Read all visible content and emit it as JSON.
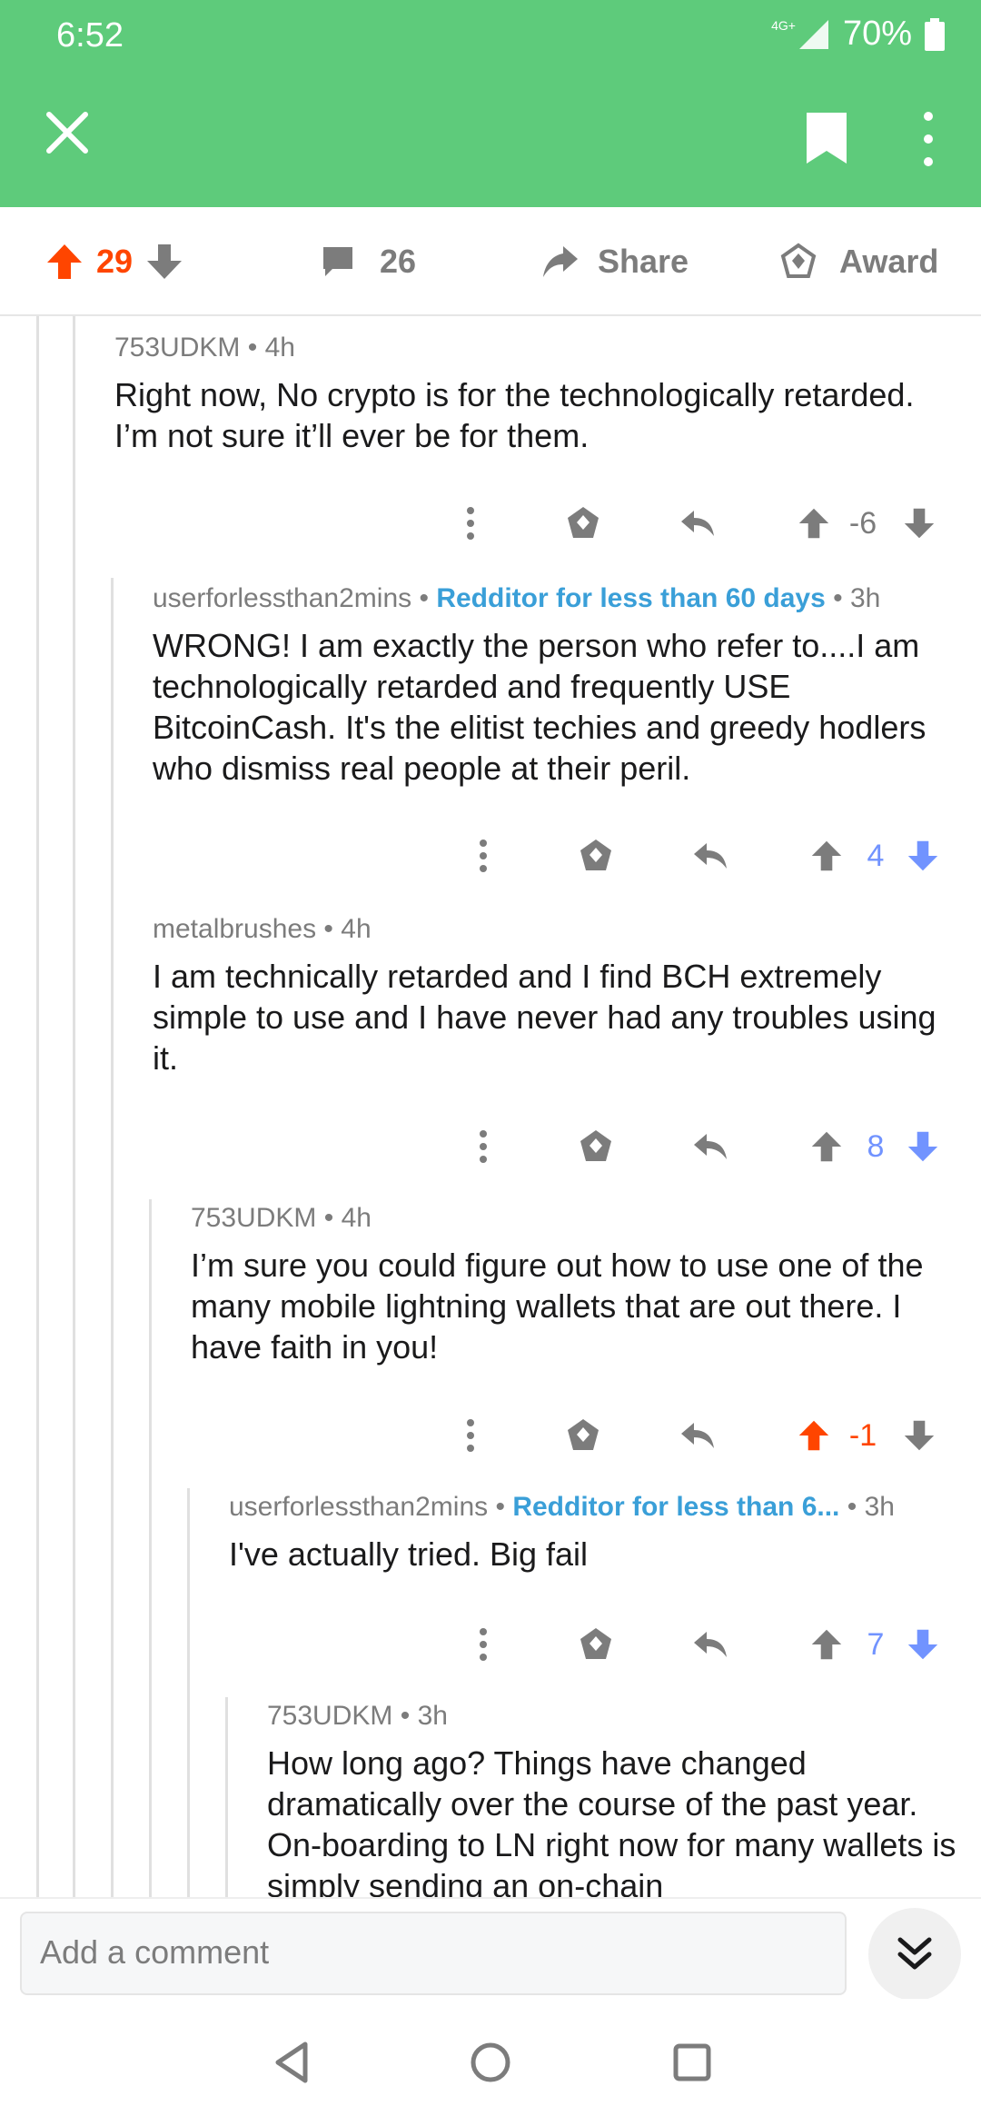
{
  "status_bar": {
    "time": "6:52",
    "network": "4G+",
    "battery": "70%"
  },
  "post_actions": {
    "upvotes": "29",
    "comments": "26",
    "share_label": "Share",
    "award_label": "Award"
  },
  "comments": [
    {
      "author": "753UDKM",
      "flair": "",
      "age": "4h",
      "body": "Right now, No crypto is for the technologically retarded. I’m not sure it’ll ever be for them.",
      "score": "-6"
    },
    {
      "author": "userforlessthan2mins",
      "flair": "Redditor for less than 60 days",
      "age": "3h",
      "body": "WRONG! I am exactly the person who refer to....I am technologically retarded and frequently USE BitcoinCash. It's the elitist techies and greedy hodlers who dismiss real people at their peril.",
      "score": "4"
    },
    {
      "author": "metalbrushes",
      "flair": "",
      "age": "4h",
      "body": "I am technically retarded and I find BCH extremely simple to use and I have never had any troubles using it.",
      "score": "8"
    },
    {
      "author": "753UDKM",
      "flair": "",
      "age": "4h",
      "body": "I’m sure you could figure out how to use one of the many mobile lightning wallets that are out there. I have faith in you!",
      "score": "-1"
    },
    {
      "author": "userforlessthan2mins",
      "flair": "Redditor for less than 6...",
      "age": "3h",
      "body": "I've actually tried. Big fail",
      "score": "7"
    },
    {
      "author": "753UDKM",
      "flair": "",
      "age": "3h",
      "body": "How long ago?  Things have changed dramatically over the course of the past year.  On-boarding to LN right now for many wallets is simply sending an on-chain",
      "score": ""
    }
  ],
  "composer": {
    "placeholder": "Add a comment"
  },
  "colors": {
    "app_bar": "#5ecb7b",
    "upvote_active": "#ff4500",
    "downvote_active": "#7193ff",
    "flair": "#3a9fd8",
    "muted": "#7c7c7c"
  }
}
